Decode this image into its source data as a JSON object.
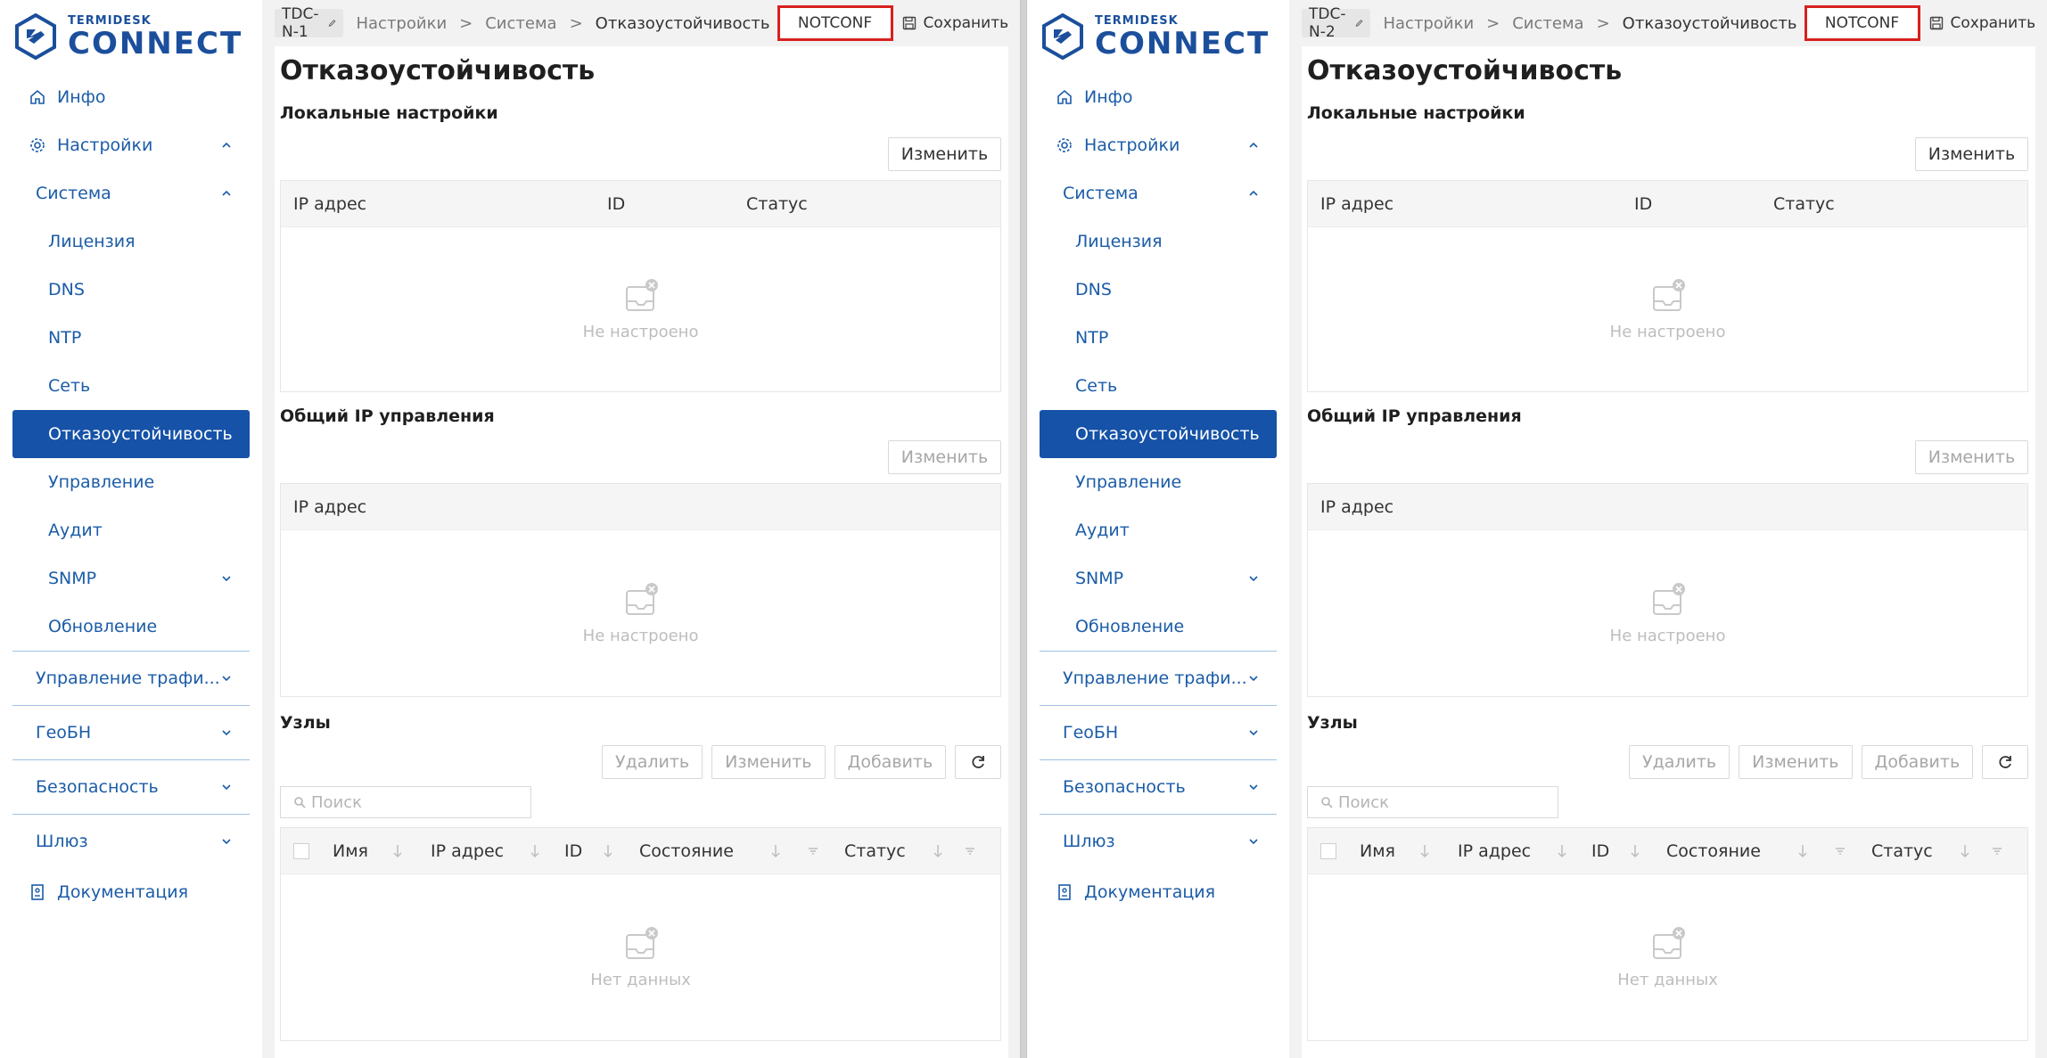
{
  "brand": {
    "small": "TERMIDESK",
    "big": "CONNECT"
  },
  "sidebar": {
    "items": [
      {
        "label": "Инфо"
      },
      {
        "label": "Настройки"
      },
      {
        "label": "Система"
      },
      {
        "label": "Лицензия"
      },
      {
        "label": "DNS"
      },
      {
        "label": "NTP"
      },
      {
        "label": "Сеть"
      },
      {
        "label": "Отказоустойчивость"
      },
      {
        "label": "Управление"
      },
      {
        "label": "Аудит"
      },
      {
        "label": "SNMP"
      },
      {
        "label": "Обновление"
      },
      {
        "label": "Управление трафи..."
      },
      {
        "label": "ГеоБН"
      },
      {
        "label": "Безопасность"
      },
      {
        "label": "Шлюз"
      },
      {
        "label": "Документация"
      }
    ]
  },
  "breadcrumb": {
    "items": [
      "Настройки",
      "Система",
      "Отказоустойчивость"
    ],
    "separator": ">"
  },
  "toolbar": {
    "save_label": "Сохранить"
  },
  "page": {
    "title": "Отказоустойчивость",
    "local": {
      "title": "Локальные настройки",
      "edit_label": "Изменить",
      "columns": [
        "IP адрес",
        "ID",
        "Статус"
      ],
      "empty_text": "Не настроено"
    },
    "mgmt": {
      "title": "Общий IP управления",
      "edit_label": "Изменить",
      "columns": [
        "IP адрес"
      ],
      "empty_text": "Не настроено"
    },
    "nodes": {
      "title": "Узлы",
      "delete_label": "Удалить",
      "edit_label": "Изменить",
      "add_label": "Добавить",
      "search_placeholder": "Поиск",
      "columns": [
        "Имя",
        "IP адрес",
        "ID",
        "Состояние",
        "Статус"
      ],
      "empty_text": "Нет данных"
    }
  },
  "panes": [
    {
      "node": "TDC-N-1",
      "status": "NOTCONF"
    },
    {
      "node": "TDC-N-2",
      "status": "NOTCONF"
    }
  ],
  "colors": {
    "accent": "#1552a8",
    "link": "#1b5ca8",
    "highlight": "#d8201e"
  }
}
